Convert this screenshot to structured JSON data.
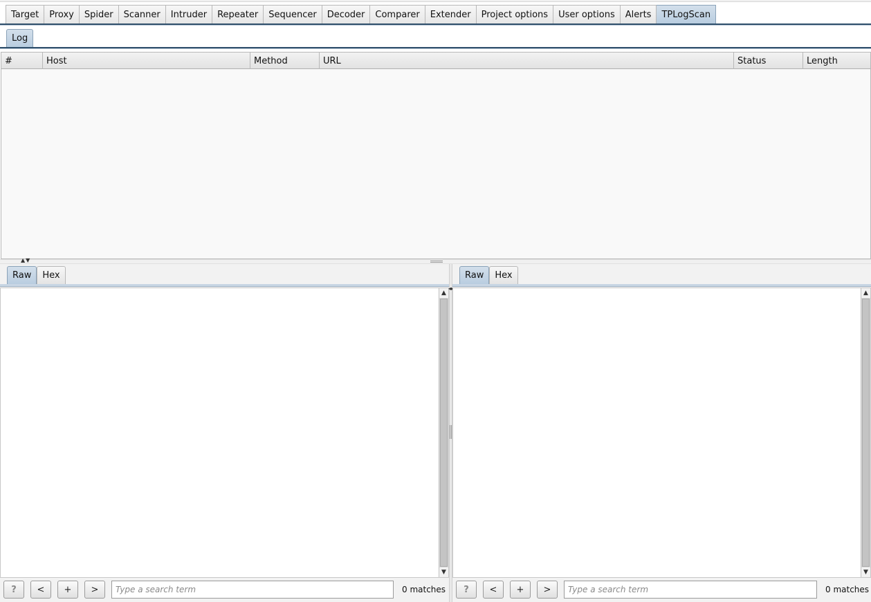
{
  "main_tabs": [
    "Target",
    "Proxy",
    "Spider",
    "Scanner",
    "Intruder",
    "Repeater",
    "Sequencer",
    "Decoder",
    "Comparer",
    "Extender",
    "Project options",
    "User options",
    "Alerts",
    "TPLogScan"
  ],
  "active_main_tab": "TPLogScan",
  "sub_tabs": [
    "Log"
  ],
  "log_table": {
    "columns": [
      "#",
      "Host",
      "Method",
      "URL",
      "Status",
      "Length"
    ],
    "rows": []
  },
  "request_pane": {
    "tabs": [
      "Raw",
      "Hex"
    ],
    "active_tab": "Raw",
    "content": "",
    "search": {
      "help_label": "?",
      "prev_label": "<",
      "add_label": "+",
      "next_label": ">",
      "placeholder": "Type a search term",
      "matches": "0 matches"
    }
  },
  "response_pane": {
    "tabs": [
      "Raw",
      "Hex"
    ],
    "active_tab": "Raw",
    "content": "",
    "search": {
      "help_label": "?",
      "prev_label": "<",
      "add_label": "+",
      "next_label": ">",
      "placeholder": "Type a search term",
      "matches": "0 matches"
    }
  },
  "colors": {
    "active_tab": "#c6d6e6",
    "tab_rule": "#2f4f6b",
    "table_bg": "#f9f9f9"
  }
}
